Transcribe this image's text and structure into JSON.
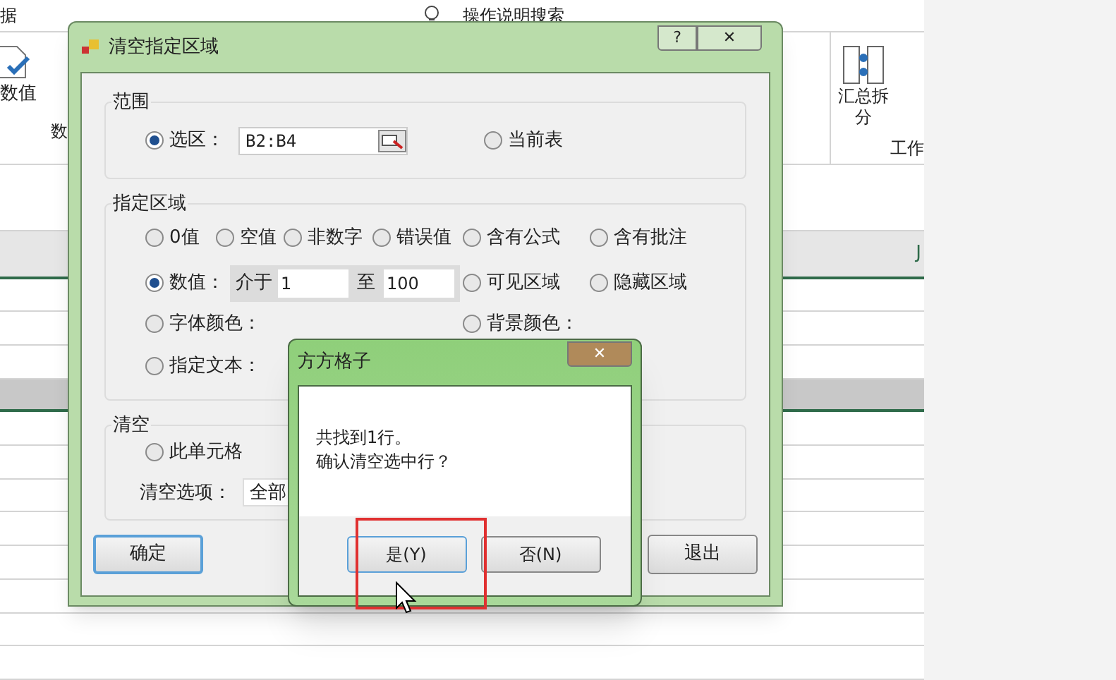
{
  "ribbon": {
    "tab_fragment": "据",
    "tell_me": "操作说明搜索",
    "left_button": "数值",
    "left_group": "数",
    "right_button_line1": "汇总拆",
    "right_button_line2": "分",
    "right_group": "工作"
  },
  "sheet": {
    "column_header": "J",
    "selected_row": true
  },
  "dialog": {
    "title": "清空指定区域",
    "help": "?",
    "close": "✕",
    "range_group": {
      "label": "范围",
      "options": [
        {
          "label": "选区：",
          "selected": true,
          "value": "B2:B4"
        },
        {
          "label": "当前表",
          "selected": false
        }
      ]
    },
    "area_group": {
      "label": "指定区域",
      "rows": [
        [
          {
            "label": "0值",
            "selected": false
          },
          {
            "label": "空值",
            "selected": false
          },
          {
            "label": "非数字",
            "selected": false
          },
          {
            "label": "错误值",
            "selected": false
          },
          {
            "label": "含有公式",
            "selected": false
          },
          {
            "label": "含有批注",
            "selected": false
          }
        ],
        [
          {
            "label": "数值：",
            "selected": true,
            "kind": "range",
            "between": "介于",
            "from": "1",
            "to_label": "至",
            "to": "100"
          },
          "",
          "",
          "",
          {
            "label": "可见区域",
            "selected": false
          },
          {
            "label": "隐藏区域",
            "selected": false
          }
        ],
        [
          {
            "label": "字体颜色：",
            "selected": false
          },
          "",
          "",
          "",
          {
            "label": "背景颜色：",
            "selected": false
          }
        ],
        [
          {
            "label": "指定文本：",
            "selected": false
          }
        ]
      ]
    },
    "clear_group": {
      "label": "清空",
      "option": {
        "label": "此单元格",
        "selected": false
      },
      "options_label": "清空选项：",
      "options_value": "全部"
    },
    "ok": "确定",
    "exit": "退出"
  },
  "message_box": {
    "title": "方方格子",
    "close": "✕",
    "lines": [
      "共找到1行。",
      "确认清空选中行？"
    ],
    "yes": "是(Y)",
    "no": "否(N)",
    "highlighted": true
  }
}
